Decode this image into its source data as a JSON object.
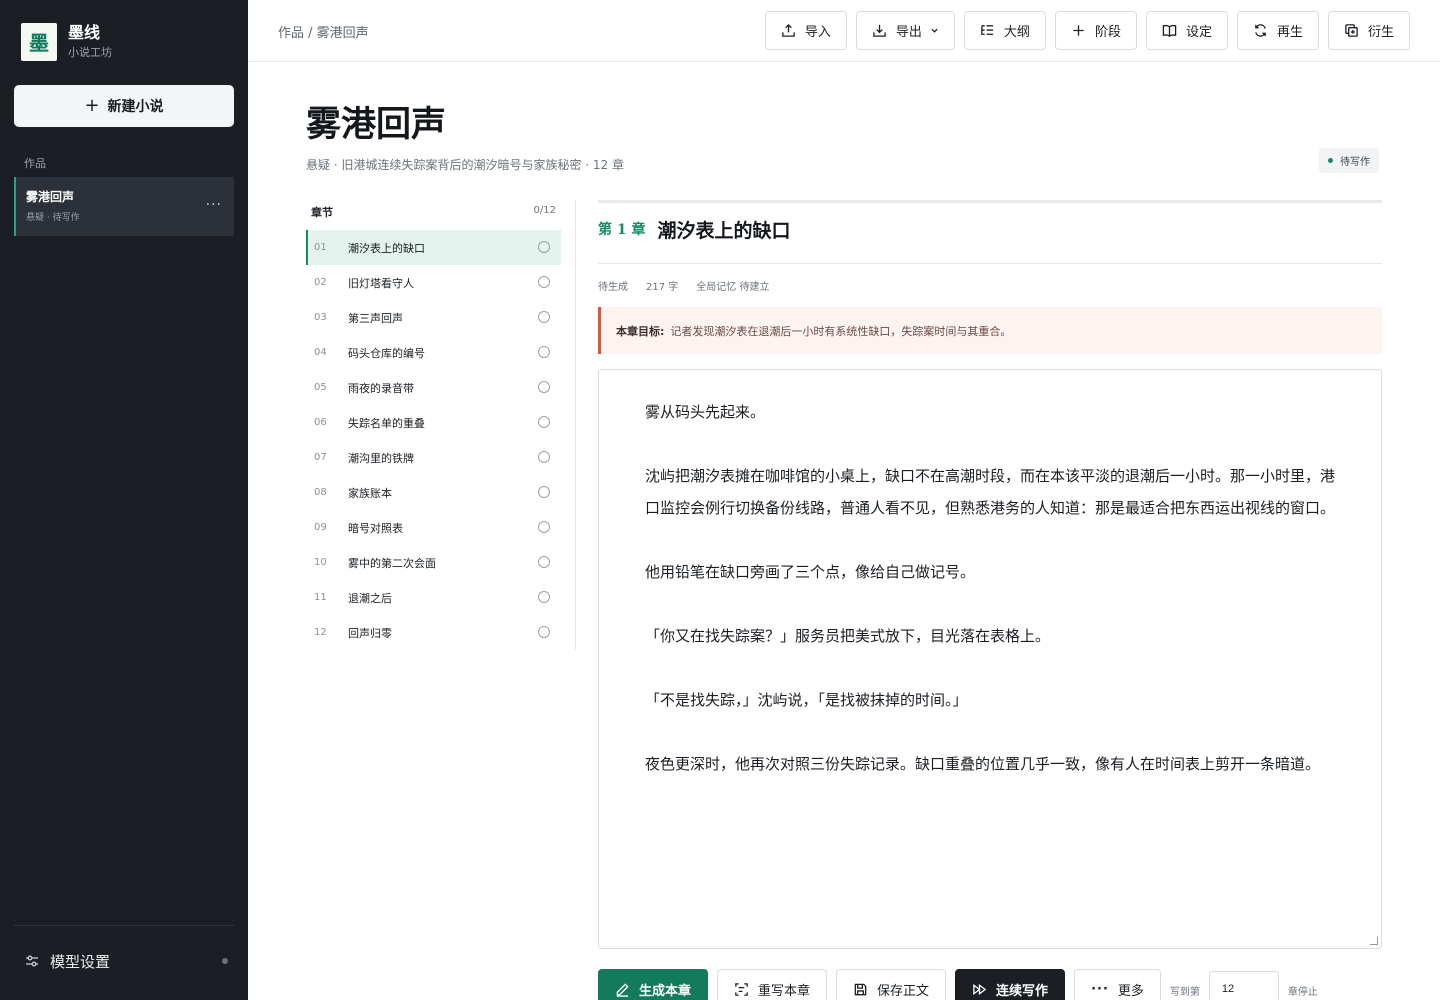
{
  "app": {
    "logo_char": "墨",
    "name": "墨线",
    "subtitle": "小说工坊"
  },
  "sidebar": {
    "new_novel_label": "新建小说",
    "section_label": "作品",
    "works": [
      {
        "title": "雾港回声",
        "meta": "悬疑 · 待写作"
      }
    ],
    "model_settings_label": "模型设置"
  },
  "topbar": {
    "breadcrumb": "作品 / 雾港回声",
    "buttons": {
      "import": "导入",
      "export": "导出",
      "outline": "大纲",
      "stage": "阶段",
      "settings": "设定",
      "regenerate": "再生",
      "derive": "衍生"
    }
  },
  "novel": {
    "title": "雾港回声",
    "meta": "悬疑 · 旧港城连续失踪案背后的潮汐暗号与家族秘密 · 12 章",
    "status": "待写作"
  },
  "chapters": {
    "label": "章节",
    "progress": "0/12",
    "items": [
      {
        "num": "01",
        "title": "潮汐表上的缺口"
      },
      {
        "num": "02",
        "title": "旧灯塔看守人"
      },
      {
        "num": "03",
        "title": "第三声回声"
      },
      {
        "num": "04",
        "title": "码头仓库的编号"
      },
      {
        "num": "05",
        "title": "雨夜的录音带"
      },
      {
        "num": "06",
        "title": "失踪名单的重叠"
      },
      {
        "num": "07",
        "title": "潮沟里的铁牌"
      },
      {
        "num": "08",
        "title": "家族账本"
      },
      {
        "num": "09",
        "title": "暗号对照表"
      },
      {
        "num": "10",
        "title": "雾中的第二次会面"
      },
      {
        "num": "11",
        "title": "退潮之后"
      },
      {
        "num": "12",
        "title": "回声归零"
      }
    ]
  },
  "editor": {
    "chapter_no": "第 1 章",
    "chapter_title": "潮汐表上的缺口",
    "state": "待生成",
    "word_count": "217 字",
    "memory": "全局记忆 待建立",
    "goal_label": "本章目标:",
    "goal_text": "记者发现潮汐表在退潮后一小时有系统性缺口，失踪案时间与其重合。",
    "paragraphs": [
      "雾从码头先起来。",
      "沈屿把潮汐表摊在咖啡馆的小桌上，缺口不在高潮时段，而在本该平淡的退潮后一小时。那一小时里，港口监控会例行切换备份线路，普通人看不见，但熟悉港务的人知道：那是最适合把东西运出视线的窗口。",
      "他用铅笔在缺口旁画了三个点，像给自己做记号。",
      "「你又在找失踪案？」服务员把美式放下，目光落在表格上。",
      "「不是找失踪，」沈屿说，「是找被抹掉的时间。」",
      "夜色更深时，他再次对照三份失踪记录。缺口重叠的位置几乎一致，像有人在时间表上剪开一条暗道。"
    ]
  },
  "actions": {
    "generate": "生成本章",
    "rewrite": "重写本章",
    "save": "保存正文",
    "continuous": "连续写作",
    "more": "更多",
    "stop_prefix": "写到第",
    "stop_value": "12",
    "stop_suffix": "章停止"
  }
}
